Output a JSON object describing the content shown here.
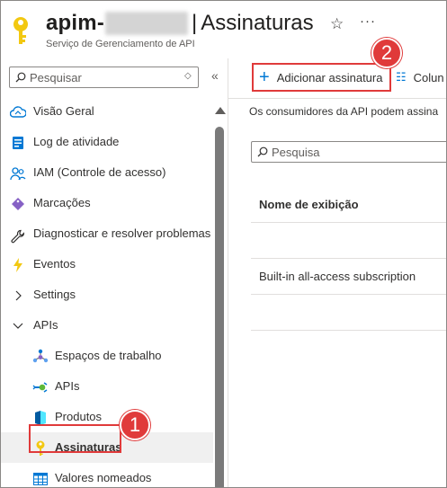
{
  "header": {
    "name_visible": "apim-",
    "separator": "|",
    "page_title": "Assinaturas",
    "subtitle": "Serviço de Gerenciamento de API",
    "star_icon": "☆",
    "more_icon": "···"
  },
  "sidebar": {
    "search_placeholder": "Pesquisar",
    "sort_icon": "◇",
    "collapse_icon": "«",
    "items": [
      {
        "label": "Visão Geral",
        "icon": "cloud-icon",
        "level": 0
      },
      {
        "label": "Log de atividade",
        "icon": "log-icon",
        "level": 0
      },
      {
        "label": "IAM (Controle de acesso)",
        "icon": "people-icon",
        "level": 0
      },
      {
        "label": "Marcações",
        "icon": "tag-icon",
        "level": 0
      },
      {
        "label": "Diagnosticar e resolver problemas",
        "icon": "wrench-icon",
        "level": 0
      },
      {
        "label": "Eventos",
        "icon": "lightning-icon",
        "level": 0
      },
      {
        "label": "Settings",
        "icon": "chevron-right-icon",
        "level": 0
      },
      {
        "label": "APIs",
        "icon": "chevron-down-icon",
        "level": 0
      },
      {
        "label": "Espaços de trabalho",
        "icon": "workspace-icon",
        "level": 1
      },
      {
        "label": "APIs",
        "icon": "api-icon",
        "level": 1
      },
      {
        "label": "Produtos",
        "icon": "product-icon",
        "level": 1
      },
      {
        "label": "Assinaturas",
        "icon": "key-icon",
        "level": 1,
        "active": true
      },
      {
        "label": "Valores nomeados",
        "icon": "grid-icon",
        "level": 1
      }
    ]
  },
  "toolbar": {
    "add_label": "Adicionar assinatura",
    "columns_label": "Colun"
  },
  "main": {
    "description": "Os consumidores da API podem assina",
    "filter_placeholder": "Pesquisa",
    "table": {
      "header": "Nome de exibição",
      "rows": [
        "",
        "Built-in all-access subscription",
        ""
      ]
    }
  },
  "annotations": {
    "step1": "1",
    "step2": "2",
    "color": "#e03a3a"
  }
}
